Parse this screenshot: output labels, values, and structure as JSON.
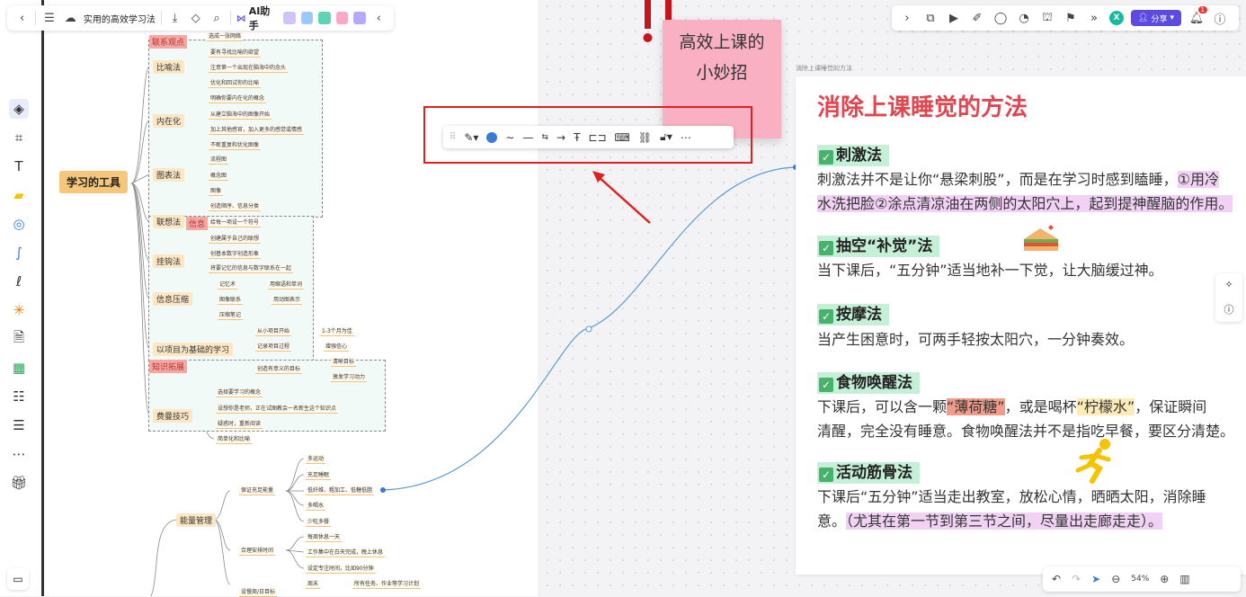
{
  "topbar": {
    "doc_title": "实用的高效学习法",
    "ai_label": "AI助手"
  },
  "topbar_right": {
    "avatar_letter": "X",
    "share_label": "分享",
    "notif_count": "1"
  },
  "mindmap": {
    "root": "学习的工具",
    "tag_lianxi": "联系观点",
    "tag_zhishi": "知识拓展",
    "tag_xinxi": "信息",
    "branches": [
      {
        "label": "比喻法",
        "items": [
          "要有寻找比喻的欲望",
          "注意第一个出现在脑海中的念头",
          "优化和回试你的比喻"
        ]
      },
      {
        "label": "内在化",
        "items": [
          "明确你要内在化的概念",
          "从建立脑海中的图像开始",
          "加上其他感官，加入更多的感觉或情感",
          "不断重复和优化图像"
        ]
      },
      {
        "label": "图表法",
        "items": [
          "流程图",
          "概念图",
          "图像",
          "创造顺序、信息分类"
        ]
      },
      {
        "label": "联想法",
        "items": [
          "给每一项设一个符号",
          "创建属于自己的联想"
        ]
      },
      {
        "label": "挂钩法",
        "items": [
          "创基本数字创造形象",
          "将要记忆的信息与数字联系在一起"
        ]
      },
      {
        "label": "信息压缩",
        "items": [
          "记忆术",
          "图像联系",
          "压缩笔记"
        ],
        "subitems": [
          "用缩语和单词",
          "用动图表示"
        ]
      },
      {
        "label": "以项目为基础的学习",
        "items": [
          "从小项目开始",
          "记录项目过程",
          "创造有意义的目标"
        ],
        "subitems": [
          "1-3个月为佳",
          "增强信心",
          "清晰目标",
          "激发学习动力"
        ]
      },
      {
        "label": "费曼技巧",
        "items": [
          "选择要学习的概念",
          "设想你是老师，正在试图教会一名新生这个知识点",
          "疑惑时，重新阅读",
          "简单化和比喻"
        ]
      }
    ],
    "top_item": "选成一张网络",
    "energy": {
      "label": "能量管理",
      "sub1": "保证充足能量",
      "sub1_items": [
        "多运动",
        "充足睡眠",
        "低纤维、粗加工、低糖低脂",
        "多喝水",
        "少吃多餐"
      ],
      "sub2": "合理安排时间",
      "sub2_items": [
        "每周休息一天",
        "工作集中在白天完成，晚上休息",
        "设定专注时间，比如90分钟"
      ],
      "sub3": "设慢周/日目标",
      "sub3_items": [
        "周末",
        "所有任务、作业等学习计划"
      ]
    }
  },
  "sticky": {
    "line1": "高效上课的",
    "line2": "小妙招"
  },
  "doc": {
    "label": "消除上课睡觉的方法",
    "title": "消除上课睡觉的方法",
    "sections": [
      {
        "title": "刺激法",
        "lines": [
          [
            "刺激法并不是让你“悬梁刺股”，而是在学习时感到瞌睡，",
            "①用冷"
          ],
          [
            "水洗把脸②涂点清凉油在两侧的太阳穴上，起到提神醒脑的作用。",
            ""
          ]
        ]
      },
      {
        "title": "抽空“补觉”法",
        "lines": [
          [
            "当下课后，“五分钟”适当地补一下觉，让大脑缓过神。"
          ]
        ]
      },
      {
        "title": "按摩法",
        "lines": [
          [
            "当产生困意时，可两手轻按太阳穴，一分钟奏效。"
          ]
        ]
      },
      {
        "title": "食物唤醒法",
        "line1_a": "下课后，可以含一颗",
        "line1_b": "“薄荷糖”",
        "line1_c": "，或是喝杯",
        "line1_d": "“柠檬水”",
        "line1_e": "，保证瞬间",
        "line2": "清醒，完全没有睡意。食物唤醒法并不是指吃早餐，要区分清楚。"
      },
      {
        "title": "活动筋骨法",
        "line1": "下课后“五分钟”适当走出教室，放松心情，晒晒太阳，消除睡",
        "line2_a": "意。",
        "line2_b": "（尤其在第一节到第三节之间，尽量出走廊走走）。"
      }
    ]
  },
  "zoom": "54%"
}
